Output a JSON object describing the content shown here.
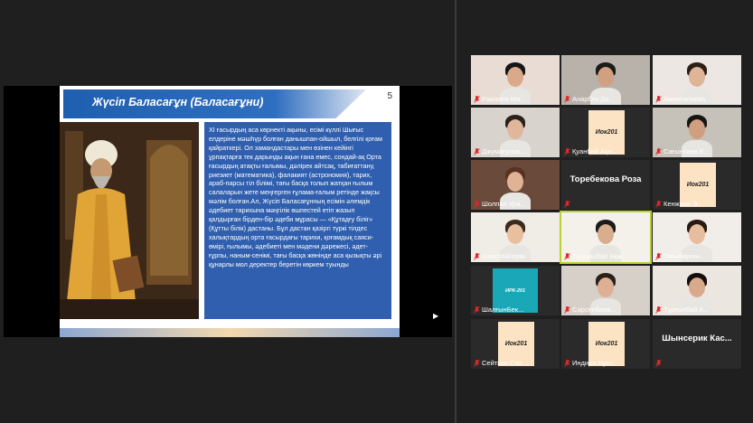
{
  "slide": {
    "title": "Жүсіп Баласағұн (Баласағұни)",
    "number": "5",
    "body_text": "XI ғасырдың аса көрнекті ақыны, есімі күллі Шығыс елдеріне мәшһүр болған данышпан-ойшыл, белгілі қоғам қайраткері. Ол замандастары мен өзінен кейінгі ұрпақтарға тек дарынды ақын ғана емес, сондай-ақ Орта ғасырдың атақты ғалымы, дәлірек айтсақ, табиғаттану, риезиет (математика), фалакият (астрономия), тарих, араб-парсы тіл білімі, тағы басқа толып жатқан ғылым салаларын жете меңгерген ғұлама-ғалым ретінде жақсы мәлім болған.Ал, Жүсіп Баласағұнның есімін әлемдік әдебиет тарихына мәңгілік өшпестей етіп жазып қалдырған бірден-бір әдеби мұрасы — «Құтадғу біліг» (Құтты білік) дастаны. Бұл дастан қазіргі түркі тілдес халықтардың орта ғасырдағы тарихи, қоғамдық саяси-өмірі, ғылымы, әдебиеті мен мәдени дәрежесі, әдет-ғұрпы, наным-сенімі, тағы басқа жөнінде аса қызықты әрі құнарлы мол деректер беретін көркем туынды"
  },
  "participants": [
    {
      "name": "Рамазов Ма...",
      "type": "video"
    },
    {
      "name": "Анарбек Да...",
      "type": "video"
    },
    {
      "name": "Аманғалиева...",
      "type": "video"
    },
    {
      "name": "Джумагулов...",
      "type": "video"
    },
    {
      "name": "Қуанбай Ақн...",
      "type": "card",
      "card_text": "Иок201"
    },
    {
      "name": "Сағынтаев Е...",
      "type": "video"
    },
    {
      "name": "Шолпан Ура...",
      "type": "video"
    },
    {
      "name": "Торебекова Роза",
      "type": "name_only"
    },
    {
      "name": "Кенжава Э...",
      "type": "card",
      "card_text": "Иок201"
    },
    {
      "name": "АхметАйгерім",
      "type": "video"
    },
    {
      "name": "Тұңғышбай Ақм...",
      "type": "video"
    },
    {
      "name": "Тағыберген...",
      "type": "video"
    },
    {
      "name": "ШалғынБек...",
      "type": "logo",
      "card_text": "ИРК-201"
    },
    {
      "name": "Сарсенбаев...",
      "type": "video"
    },
    {
      "name": "Тұрғынбай А...",
      "type": "video"
    },
    {
      "name": "Сейткан Сая...",
      "type": "card",
      "card_text": "Иок201"
    },
    {
      "name": "Индира Нуст...",
      "type": "card",
      "card_text": "Иок201"
    },
    {
      "name": "Шынсерик Кас...",
      "type": "name_only"
    }
  ],
  "colors": {
    "slide_title_bar": "#1f5fb0",
    "slide_text_box": "#2f5fae",
    "active_speaker_border": "#b8d133",
    "muted_mic": "#e02828",
    "card_bg": "#fce3c4"
  }
}
